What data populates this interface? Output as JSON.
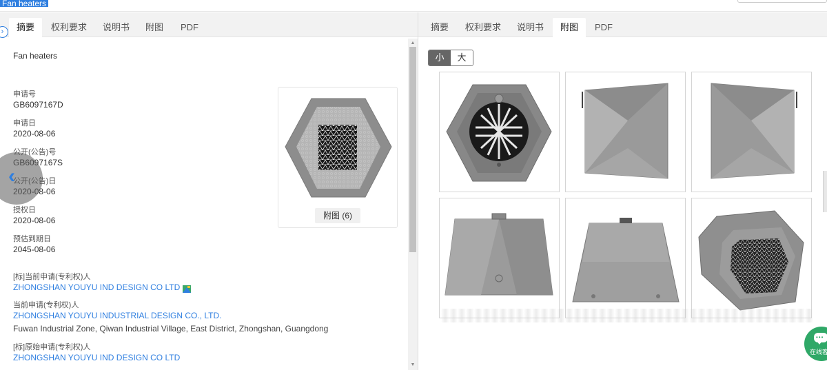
{
  "window": {
    "selected_title": "Fan heaters"
  },
  "left_tabs": [
    "摘要",
    "权利要求",
    "说明书",
    "附图",
    "PDF"
  ],
  "right_tabs": [
    "摘要",
    "权利要求",
    "说明书",
    "附图",
    "PDF"
  ],
  "left_active_tab": "摘要",
  "right_active_tab": "附图",
  "abstract": {
    "title": "Fan heaters",
    "fields": [
      {
        "label": "申请号",
        "value": "GB6097167D"
      },
      {
        "label": "申请日",
        "value": "2020-08-06"
      },
      {
        "label": "公开(公告)号",
        "value": "GB6097167S"
      },
      {
        "label": "公开(公告)日",
        "value": "2020-08-06"
      },
      {
        "label": "授权日",
        "value": "2020-08-06"
      },
      {
        "label": "预估到期日",
        "value": "2045-08-06"
      }
    ],
    "current_applicant_std_label": "[标]当前申请(专利权)人",
    "current_applicant_std": "ZHONGSHAN YOUYU IND DESIGN CO LTD",
    "current_applicant_label": "当前申请(专利权)人",
    "current_applicant": "ZHONGSHAN YOUYU INDUSTRIAL DESIGN CO., LTD.",
    "address": "Fuwan Industrial Zone, Qiwan Industrial Village, East District, Zhongshan, Guangdong",
    "original_applicant_std_label": "[标]原始申请(专利权)人",
    "original_applicant_std": "ZHONGSHAN YOUYU IND DESIGN CO LTD"
  },
  "thumbnail": {
    "button_label": "附图 (6)"
  },
  "figures": {
    "size_small": "小",
    "size_large": "大",
    "selected_size": "小",
    "count": 6
  },
  "chat": {
    "label": "在线客"
  },
  "colors": {
    "link": "#2f7fe0",
    "chat": "#2fa867",
    "product_gray": "#8a8a8a"
  }
}
